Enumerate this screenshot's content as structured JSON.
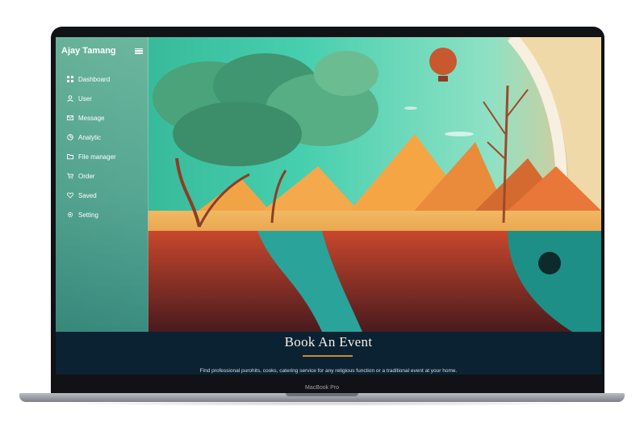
{
  "app": {
    "user_name": "Ajay Tamang"
  },
  "sidebar": {
    "items": [
      {
        "label": "Dashboard",
        "icon": "grid-icon"
      },
      {
        "label": "User",
        "icon": "user-icon"
      },
      {
        "label": "Message",
        "icon": "message-icon"
      },
      {
        "label": "Analytic",
        "icon": "pie-chart-icon"
      },
      {
        "label": "File manager",
        "icon": "folder-icon"
      },
      {
        "label": "Order",
        "icon": "cart-icon"
      },
      {
        "label": "Saved",
        "icon": "heart-icon"
      },
      {
        "label": "Setting",
        "icon": "gear-icon"
      }
    ]
  },
  "hero": {
    "title": "Book An Event",
    "description": "Find professional purohits, cooks, catering service for any religious function or a traditional event at your home."
  },
  "device": {
    "label": "MacBook Pro"
  },
  "colors": {
    "accent": "#c98b38",
    "hero_bg": "#0b2232",
    "sky": "#3fc7a8"
  }
}
